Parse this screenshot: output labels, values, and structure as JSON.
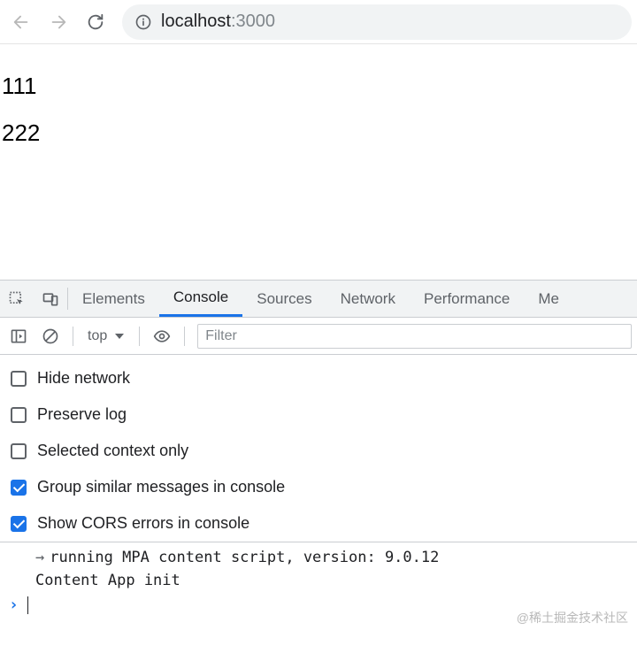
{
  "browser": {
    "url_host": "localhost",
    "url_port": ":3000"
  },
  "page": {
    "line1": "111",
    "line2": "222"
  },
  "devtools": {
    "tabs": {
      "elements": "Elements",
      "console": "Console",
      "sources": "Sources",
      "network": "Network",
      "performance": "Performance",
      "more": "Me"
    },
    "toolbar": {
      "context": "top",
      "filter_placeholder": "Filter"
    },
    "settings": {
      "hide_network": {
        "label": "Hide network",
        "checked": false
      },
      "preserve_log": {
        "label": "Preserve log",
        "checked": false
      },
      "selected_context": {
        "label": "Selected context only",
        "checked": false
      },
      "group_similar": {
        "label": "Group similar messages in console",
        "checked": true
      },
      "show_cors": {
        "label": "Show CORS errors in console",
        "checked": true
      }
    },
    "logs": {
      "l1_arrow": "→",
      "l1": "running MPA content script, version: 9.0.12",
      "l2": "Content App init"
    }
  },
  "watermark": "@稀土掘金技术社区"
}
